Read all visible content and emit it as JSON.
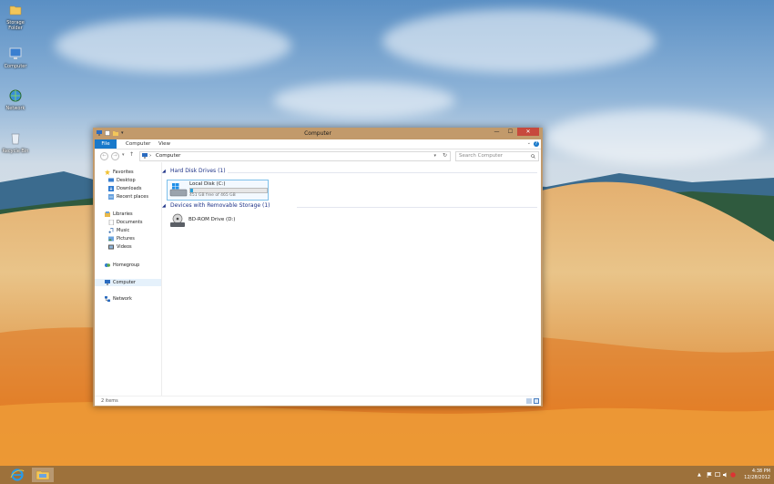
{
  "desktop": {
    "icons": [
      {
        "label": "Storage Folder",
        "icon": "folder-icon"
      },
      {
        "label": "Computer",
        "icon": "computer-icon"
      },
      {
        "label": "Network",
        "icon": "network-icon"
      },
      {
        "label": "Recycle Bin",
        "icon": "recycle-bin-icon"
      }
    ]
  },
  "window": {
    "title": "Computer",
    "tabs": [
      "File",
      "Computer",
      "View"
    ],
    "address": {
      "separator": "›",
      "location": "Computer"
    },
    "search": {
      "placeholder": "Search Computer"
    },
    "nav": {
      "favorites": {
        "label": "Favorites",
        "items": [
          "Desktop",
          "Downloads",
          "Recent places"
        ]
      },
      "libraries": {
        "label": "Libraries",
        "items": [
          "Documents",
          "Music",
          "Pictures",
          "Videos"
        ]
      },
      "homegroup": "Homegroup",
      "computer": "Computer",
      "network": "Network"
    },
    "groups": [
      {
        "header": "Hard Disk Drives (1)",
        "item": {
          "name": "Local Disk (C:)",
          "free": "451 GB free of 465 GB",
          "used_fraction": 0.03
        }
      },
      {
        "header": "Devices with Removable Storage (1)",
        "item": {
          "name": "BD-ROM Drive (D:)"
        }
      }
    ],
    "status": "2 items"
  },
  "taskbar": {
    "time": "4:38 PM",
    "date": "12/28/2012"
  },
  "colors": {
    "accent": "#1979ca",
    "window_frame": "#c29a6b",
    "close": "#c7493d",
    "group_header": "#1e3287"
  }
}
